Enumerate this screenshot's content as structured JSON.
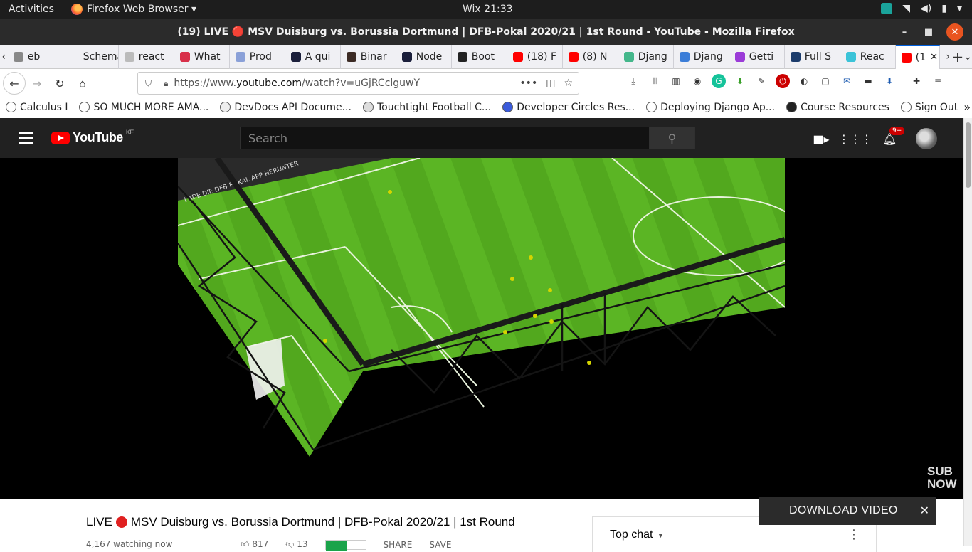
{
  "desktop": {
    "activities": "Activities",
    "app_name": "Firefox Web Browser ▾",
    "clock": "Wix 21:33"
  },
  "window": {
    "title": "(19) LIVE 🔴 MSV Duisburg vs. Borussia Dortmund | DFB-Pokal 2020/21 | 1st Round - YouTube - Mozilla Firefox",
    "minimize": "–",
    "maximize": "■",
    "close": "✕"
  },
  "tabs": [
    {
      "label": "eb",
      "color": "#888888"
    },
    {
      "label": "Schema",
      "color": "#f0f0f4"
    },
    {
      "label": "react",
      "color": "#bbbbbb"
    },
    {
      "label": "What",
      "color": "#d8304a"
    },
    {
      "label": "Prod",
      "color": "#8aa0d8"
    },
    {
      "label": "A qui",
      "color": "#1b1f3b"
    },
    {
      "label": "Binar",
      "color": "#3b2a24"
    },
    {
      "label": "Node",
      "color": "#1b1f3b"
    },
    {
      "label": "Boot",
      "color": "#222222"
    },
    {
      "label": "(18) F",
      "color": "#ff0000"
    },
    {
      "label": "(8) N",
      "color": "#ff0000"
    },
    {
      "label": "Djang",
      "color": "#44b78b"
    },
    {
      "label": "Djang",
      "color": "#3b7dd8"
    },
    {
      "label": "Getti",
      "color": "#9b3bd8"
    },
    {
      "label": "Full S",
      "color": "#1b3b6b"
    },
    {
      "label": "Reac",
      "color": "#3bc3d8"
    },
    {
      "label": "(1",
      "color": "#ff0000",
      "active": true
    }
  ],
  "tab_nav": {
    "left": "‹",
    "right": "›",
    "new_tab": "+",
    "list": "⌄",
    "close_active": "✕"
  },
  "navbar": {
    "back": "←",
    "forward": "→",
    "reload": "↻",
    "home": "⌂",
    "url_prefix": "https://www.",
    "url_domain": "youtube.com",
    "url_path": "/watch?v=uGjRCclguwY",
    "page_actions": "•••",
    "pocket": "◫",
    "star": "☆"
  },
  "bookmarks": [
    {
      "label": "Calculus I",
      "color": "#ffffff"
    },
    {
      "label": "SO MUCH MORE AMA...",
      "color": "#ffffff"
    },
    {
      "label": "DevDocs API Docume...",
      "color": "#eeeeee"
    },
    {
      "label": "Touchtight Football C...",
      "color": "#dddddd"
    },
    {
      "label": "Developer Circles Res...",
      "color": "#3b5bdb"
    },
    {
      "label": "Deploying Django Ap...",
      "color": "#ffffff"
    },
    {
      "label": "Course Resources",
      "color": "#222222"
    },
    {
      "label": "Sign Out",
      "color": "#ffffff"
    }
  ],
  "youtube": {
    "logo_text": "YouTube",
    "region": "KE",
    "search_placeholder": "Search",
    "notification_count": "9+",
    "video_title": "LIVE 🔴 MSV Duisburg vs. Borussia Dortmund | DFB-Pokal 2020/21 | 1st Round",
    "video_title_before": "LIVE",
    "video_title_after": "MSV Duisburg vs. Borussia Dortmund | DFB-Pokal 2020/21 | 1st Round",
    "watching": "4,167 watching now",
    "likes": "817",
    "dislikes": "13",
    "share": "SHARE",
    "save": "SAVE",
    "chat_mode": "Top chat",
    "overlay_line1": "SUB",
    "overlay_line2": "NOW",
    "banner_text": "LADE DIE DFB-POKAL APP HERUNTER"
  },
  "download_bar": {
    "label": "DOWNLOAD VIDEO",
    "close": "✕"
  },
  "colors": {
    "yt_red": "#ff0000",
    "pitch_green": "#58b321",
    "topbar": "#1d1d1d",
    "titlebar": "#2b2b2b",
    "accent": "#e95420"
  }
}
